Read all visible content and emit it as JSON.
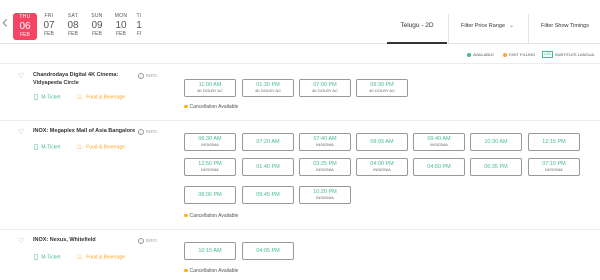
{
  "nav": {
    "prev_icon": "chevron-left"
  },
  "dates": [
    {
      "dow": "THU",
      "day": "06",
      "mon": "FEB",
      "active": true
    },
    {
      "dow": "FRI",
      "day": "07",
      "mon": "FEB",
      "active": false
    },
    {
      "dow": "SAT",
      "day": "08",
      "mon": "FEB",
      "active": false
    },
    {
      "dow": "SUN",
      "day": "09",
      "mon": "FEB",
      "active": false
    },
    {
      "dow": "MON",
      "day": "10",
      "mon": "FEB",
      "active": false
    },
    {
      "dow": "TI",
      "day": "1",
      "mon": "FI",
      "active": false
    }
  ],
  "language_tab": "Telugu - 2D",
  "filters": {
    "price": "Filter Price Range",
    "timings": "Filter Show Timings"
  },
  "legend": {
    "available": "AVAILABLE",
    "fast_filling": "FAST FILLING",
    "subtitles_badge": "LAN",
    "subtitles": "SUBTITLES LANGUA",
    "colors": {
      "available": "#49ba8e",
      "fast_filling": "#ffa426"
    }
  },
  "venue_common": {
    "info": "INFO",
    "mticket": "M-Ticket",
    "fnb": "Food & Beverage",
    "cancellation": "Cancellation Available"
  },
  "venues": [
    {
      "name_line1": "Chandrodaya Digital 4K Cinema:",
      "name_line2": "Vidyapeeta Circle",
      "shows": [
        {
          "time": "11:00 AM",
          "format": "4K DOLBY AC"
        },
        {
          "time": "01:30 PM",
          "format": "4K DOLBY AC"
        },
        {
          "time": "07:00 PM",
          "format": "4K DOLBY AC"
        },
        {
          "time": "09:30 PM",
          "format": "4K DOLBY AC"
        }
      ]
    },
    {
      "name_line1": "INOX: Megaplex Mall of Asia Bangalore",
      "shows": [
        {
          "time": "06:30 AM",
          "format": "INSIGNIA"
        },
        {
          "time": "07:20 AM",
          "format": ""
        },
        {
          "time": "07:40 AM",
          "format": "INSIGNIA"
        },
        {
          "time": "09:05 AM",
          "format": ""
        },
        {
          "time": "09:40 AM",
          "format": "INSIGNIA"
        },
        {
          "time": "10:30 AM",
          "format": ""
        },
        {
          "time": "12:15 PM",
          "format": ""
        },
        {
          "time": "12:50 PM",
          "format": "INSIGNIA"
        },
        {
          "time": "01:40 PM",
          "format": ""
        },
        {
          "time": "03:25 PM",
          "format": "INSIGNIA"
        },
        {
          "time": "04:00 PM",
          "format": "INSIGNIA"
        },
        {
          "time": "04:50 PM",
          "format": ""
        },
        {
          "time": "06:35 PM",
          "format": ""
        },
        {
          "time": "07:10 PM",
          "format": "INSIGNIA"
        },
        {
          "time": "08:00 PM",
          "format": ""
        },
        {
          "time": "09:45 PM",
          "format": ""
        },
        {
          "time": "10:20 PM",
          "format": "INSIGNIA"
        }
      ]
    },
    {
      "name_line1": "INOX: Nexus, Whitefield",
      "shows": [
        {
          "time": "10:15 AM",
          "format": ""
        },
        {
          "time": "04:05 PM",
          "format": ""
        }
      ]
    }
  ]
}
